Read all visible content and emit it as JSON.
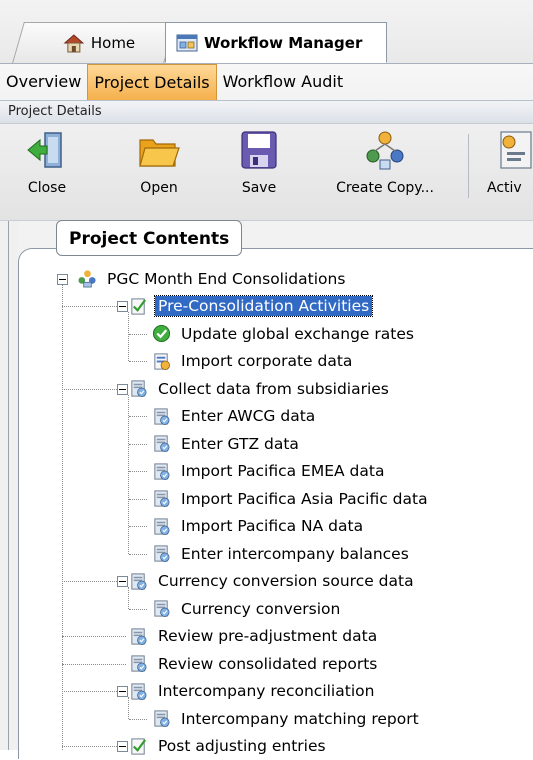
{
  "doc_tabs": [
    {
      "label": "Home",
      "icon": "house-icon"
    },
    {
      "label": "Workflow Manager",
      "icon": "workflow-manager-icon"
    }
  ],
  "ribbon": {
    "tabs": [
      {
        "label": "Overview",
        "active": false
      },
      {
        "label": "Project Details",
        "active": true
      },
      {
        "label": "Workflow Audit",
        "active": false
      }
    ],
    "group_label": "Project Details",
    "buttons": [
      {
        "label": "Close",
        "icon": "close-door-icon"
      },
      {
        "label": "Open",
        "icon": "open-folder-icon"
      },
      {
        "label": "Save",
        "icon": "floppy-disk-icon"
      },
      {
        "label": "Create Copy...",
        "icon": "create-copy-icon"
      },
      {
        "label": "Activ",
        "icon": "activate-icon"
      }
    ]
  },
  "panel": {
    "title": "Project Contents",
    "tree": [
      {
        "label": "PGC Month End Consolidations",
        "icon": "project-people-icon",
        "level": 0,
        "expanded": true
      },
      {
        "label": "Pre-Consolidation Activities",
        "icon": "check-document-icon",
        "level": 1,
        "expanded": true,
        "selected": true
      },
      {
        "label": "Update global exchange rates",
        "icon": "green-check-icon",
        "level": 2
      },
      {
        "label": "Import corporate data",
        "icon": "import-data-icon",
        "level": 2
      },
      {
        "label": "Collect data from subsidiaries",
        "icon": "task-document-icon",
        "level": 1,
        "expanded": true
      },
      {
        "label": "Enter AWCG data",
        "icon": "task-document-icon",
        "level": 2
      },
      {
        "label": "Enter GTZ data",
        "icon": "task-document-icon",
        "level": 2
      },
      {
        "label": "Import Pacifica EMEA data",
        "icon": "task-document-icon",
        "level": 2
      },
      {
        "label": "Import Pacifica Asia Pacific data",
        "icon": "task-document-icon",
        "level": 2
      },
      {
        "label": "Import Pacifica NA data",
        "icon": "task-document-icon",
        "level": 2
      },
      {
        "label": "Enter intercompany balances",
        "icon": "task-document-icon",
        "level": 2
      },
      {
        "label": "Currency conversion source data",
        "icon": "task-document-icon",
        "level": 1,
        "expanded": true
      },
      {
        "label": "Currency conversion",
        "icon": "task-document-icon",
        "level": 2
      },
      {
        "label": "Review pre-adjustment data",
        "icon": "task-document-icon",
        "level": 1
      },
      {
        "label": "Review consolidated reports",
        "icon": "task-document-icon",
        "level": 1
      },
      {
        "label": "Intercompany reconciliation",
        "icon": "task-document-icon",
        "level": 1,
        "expanded": true
      },
      {
        "label": "Intercompany matching report",
        "icon": "task-document-icon",
        "level": 2
      },
      {
        "label": "Post adjusting entries",
        "icon": "check-document-icon",
        "level": 1,
        "expanded": true
      }
    ]
  },
  "colors": {
    "active_tab": "#f5b04c",
    "selection": "#316ac5",
    "panel_border": "#8d99a6"
  }
}
